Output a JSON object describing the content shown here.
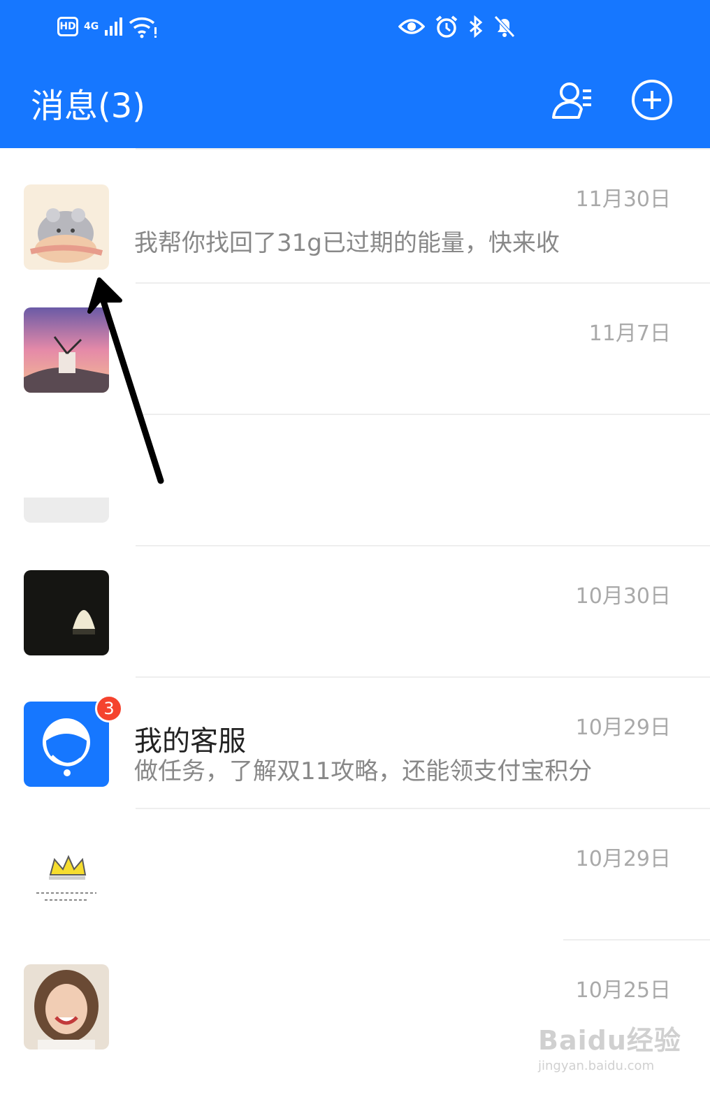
{
  "status_bar": {
    "hd": "HD",
    "network": "4G",
    "colors": {
      "bg": "#1677ff"
    }
  },
  "header": {
    "title": "消息(3)",
    "contacts_icon": "contacts-icon",
    "add_icon": "plus-circle-icon"
  },
  "messages": [
    {
      "date": "11月30日",
      "name": "",
      "preview": "我帮你找回了31g已过期的能量，快来收",
      "avatar": "hamster-avatar"
    },
    {
      "date": "11月7日",
      "name": "",
      "preview": "",
      "avatar": "windmill-avatar"
    },
    {
      "date": "",
      "name": "",
      "preview": "",
      "avatar": "gray-avatar"
    },
    {
      "date": "10月30日",
      "name": "",
      "preview": "",
      "avatar": "dark-avatar"
    },
    {
      "date": "10月29日",
      "name": "我的客服",
      "preview": "做任务，了解双11攻略，还能领支付宝积分",
      "avatar": "customer-service-avatar",
      "badge": "3"
    },
    {
      "date": "10月29日",
      "name": "",
      "preview": "",
      "avatar": "crown-avatar"
    },
    {
      "date": "10月25日",
      "name": "",
      "preview": "",
      "avatar": "woman-avatar"
    }
  ],
  "watermark": {
    "line1": "Baidu经验",
    "line2": "jingyan.baidu.com"
  }
}
